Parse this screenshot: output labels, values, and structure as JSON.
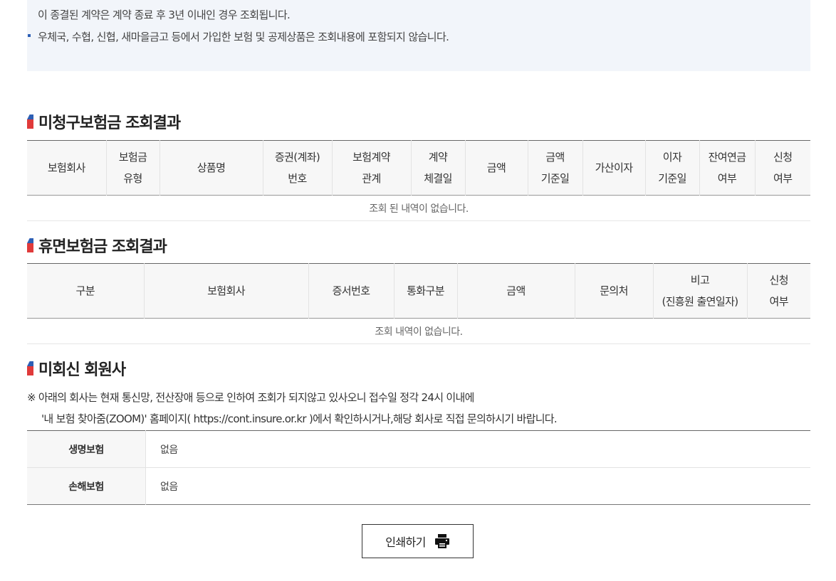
{
  "notice": {
    "line1": "이 종결된 계약은 계약 종료 후 3년 이내인 경우 조회됩니다.",
    "line2": "우체국, 수협, 신협, 새마을금고 등에서 가입한 보험 및 공제상품은 조회내용에 포함되지 않습니다."
  },
  "unclaimed": {
    "title": "미청구보험금 조회결과",
    "headers": [
      [
        "보험회사"
      ],
      [
        "보험금",
        "유형"
      ],
      [
        "상품명"
      ],
      [
        "증권(계좌)",
        "번호"
      ],
      [
        "보험계약",
        "관계"
      ],
      [
        "계약",
        "체결일"
      ],
      [
        "금액"
      ],
      [
        "금액",
        "기준일"
      ],
      [
        "가산이자"
      ],
      [
        "이자",
        "기준일"
      ],
      [
        "잔여연금",
        "여부"
      ],
      [
        "신청",
        "여부"
      ]
    ],
    "empty_message": "조회 된 내역이 없습니다."
  },
  "dormant": {
    "title": "휴면보험금 조회결과",
    "headers": [
      [
        "구분"
      ],
      [
        "보험회사"
      ],
      [
        "증서번호"
      ],
      [
        "통화구분"
      ],
      [
        "금액"
      ],
      [
        "문의처"
      ],
      [
        "비고",
        "(진흥원 출연일자)"
      ],
      [
        "신청",
        "여부"
      ]
    ],
    "empty_message": "조회 내역이 없습니다."
  },
  "no_reply": {
    "title": "미회신 회원사",
    "note_line1": "※ 아래의 회사는 현재 통신망, 전산장애 등으로 인하여 조회가 되지않고 있사오니 접수일 정각 24시 이내에",
    "note_line2": "'내 보험 찾아줌(ZOOM)' 홈페이지( https://cont.insure.or.kr )에서 확인하시거나,해당 회사로 직접 문의하시기 바랍니다.",
    "rows": [
      {
        "label": "생명보험",
        "value": "없음"
      },
      {
        "label": "손해보험",
        "value": "없음"
      }
    ]
  },
  "print_button": {
    "label": "인쇄하기",
    "icon": "printer-icon"
  }
}
